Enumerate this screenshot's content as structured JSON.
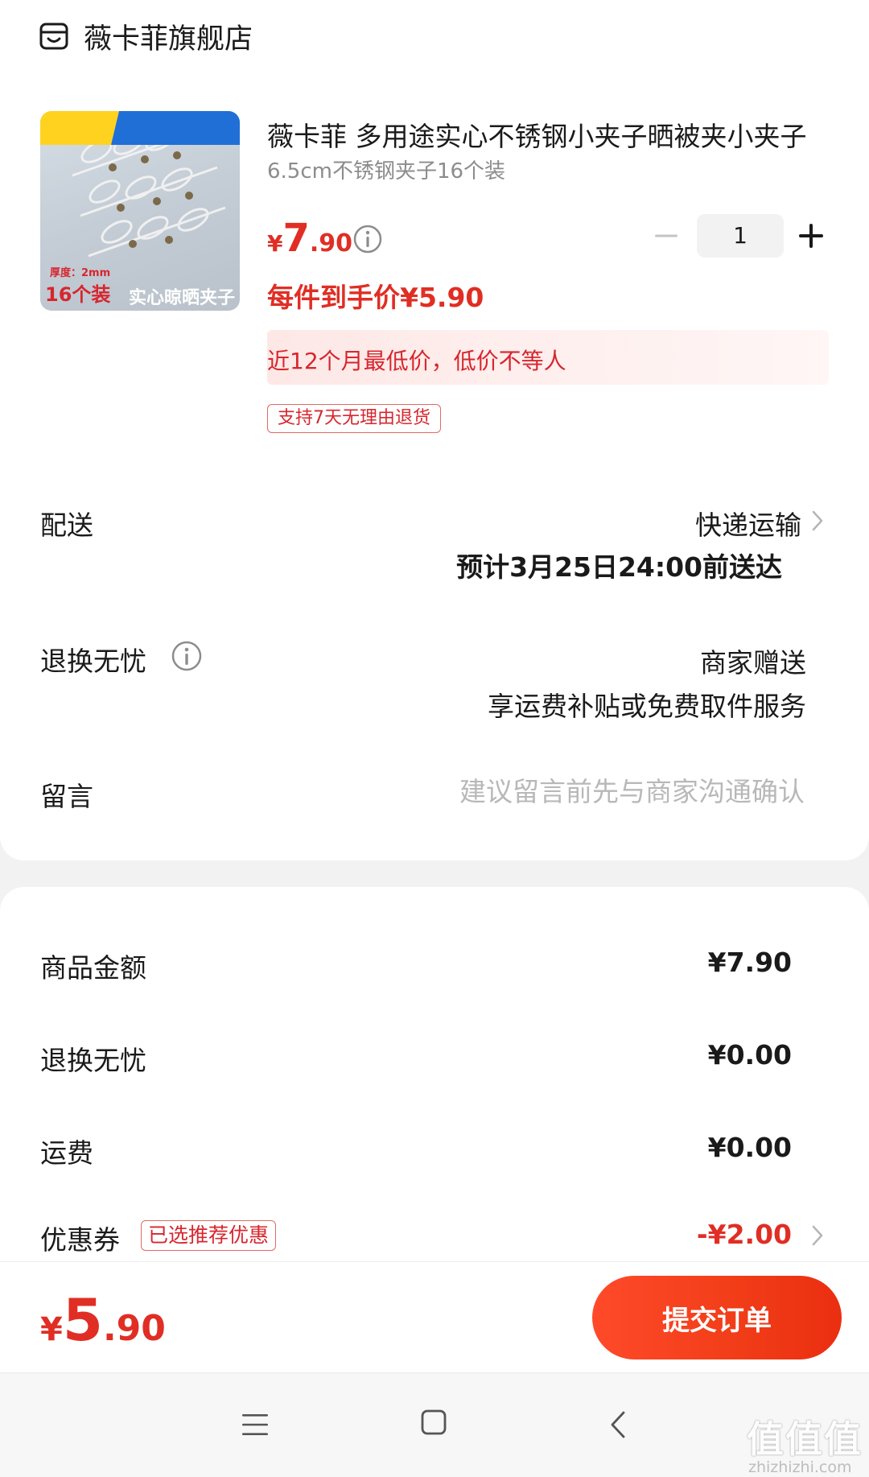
{
  "store": {
    "name": "薇卡菲旗舰店",
    "icon": "store-icon"
  },
  "product": {
    "image_badge_thickness": "厚度：2mm",
    "image_badge_count": "16个装",
    "image_badge_tag": "实心晾晒夹子",
    "title": "薇卡菲 多用途实心不锈钢小夹子晒被夹小夹子",
    "spec": "6.5cm不锈钢夹子16个装",
    "price_symbol": "¥",
    "price_int": "7",
    "price_dec": ".90",
    "hand_price": "每件到手价¥5.90",
    "lowest_note": "近12个月最低价，低价不等人",
    "return_tag": "支持7天无理由退货",
    "quantity": "1"
  },
  "delivery": {
    "label": "配送",
    "method": "快递运输",
    "eta": "预计3月25日24:00前送达"
  },
  "return_service": {
    "label": "退换无忧",
    "value1": "商家赠送",
    "value2": "享运费补贴或免费取件服务"
  },
  "message": {
    "label": "留言",
    "placeholder": "建议留言前先与商家沟通确认"
  },
  "fees": {
    "goods_label": "商品金额",
    "goods_value": "¥7.90",
    "return_label": "退换无忧",
    "return_value": "¥0.00",
    "shipping_label": "运费",
    "shipping_value": "¥0.00",
    "coupon_label": "优惠券",
    "coupon_tag": "已选推荐优惠",
    "coupon_value": "-¥2.00"
  },
  "footer": {
    "total_symbol": "¥",
    "total_int": "5",
    "total_dec": ".90",
    "submit_label": "提交订单"
  },
  "watermark": {
    "logo": "值值值",
    "url": "zhizhizhi.com"
  },
  "colors": {
    "accent_red": "#e02e24",
    "submit_gradient_start": "#ff4a2a",
    "submit_gradient_end": "#ea2f10",
    "page_background": "#f2f2f2"
  }
}
